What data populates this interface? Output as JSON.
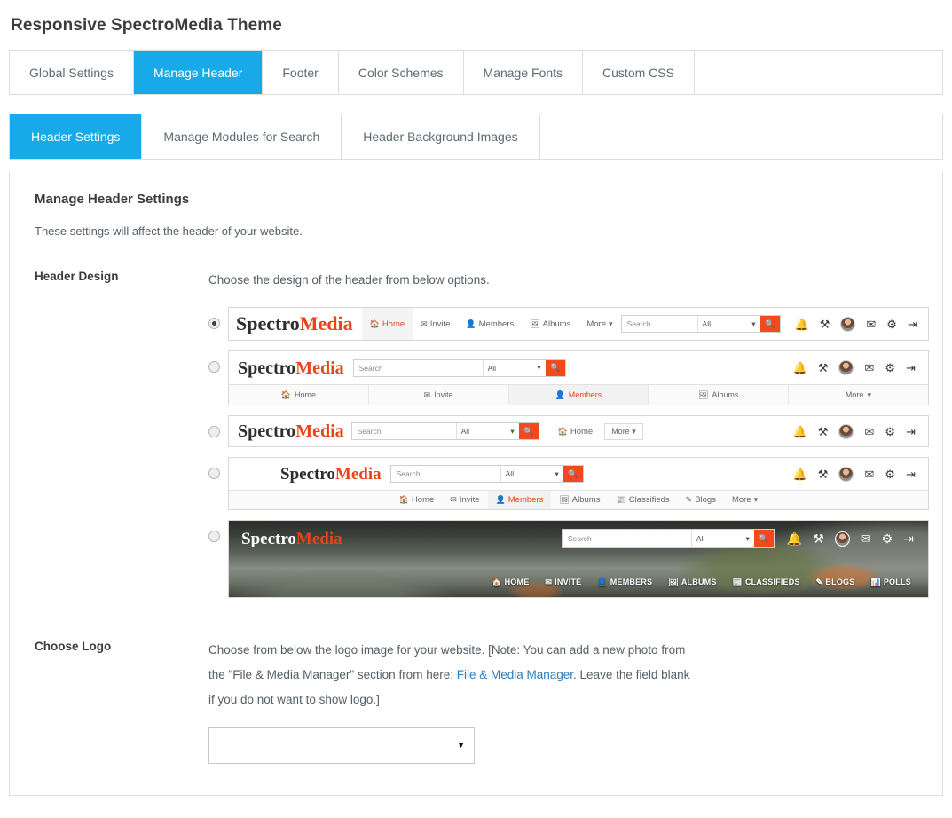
{
  "page": {
    "title": "Responsive SpectroMedia Theme"
  },
  "colors": {
    "accent_blue": "#17a9e8",
    "accent_orange": "#f4491c",
    "logo_orange": "#e8441c",
    "link_blue": "#2b7bb9",
    "border": "#dddddd"
  },
  "primary_tabs": [
    {
      "label": "Global Settings",
      "active": false
    },
    {
      "label": "Manage Header",
      "active": true
    },
    {
      "label": "Footer",
      "active": false
    },
    {
      "label": "Color Schemes",
      "active": false
    },
    {
      "label": "Manage Fonts",
      "active": false
    },
    {
      "label": "Custom CSS",
      "active": false
    }
  ],
  "secondary_tabs": [
    {
      "label": "Header Settings",
      "active": true
    },
    {
      "label": "Manage Modules for Search",
      "active": false
    },
    {
      "label": "Header Background Images",
      "active": false
    }
  ],
  "panel": {
    "heading": "Manage Header Settings",
    "description": "These settings will affect the header of your website."
  },
  "header_design": {
    "label": "Header Design",
    "help": "Choose the design of the header from below options.",
    "selected_index": 0
  },
  "logo": {
    "part1": "Spectro",
    "part2": "Media"
  },
  "search": {
    "placeholder": "Search",
    "scope": "All",
    "caret": "⌄",
    "button_icon": "search-icon"
  },
  "icons": {
    "bell": "bell-icon",
    "tools": "tools-icon",
    "avatar": "avatar-icon",
    "envelope": "envelope-icon",
    "gear": "gear-icon",
    "logout": "logout-icon"
  },
  "design1": {
    "nav": [
      {
        "label": "Home",
        "glyph": "🏠",
        "active": true
      },
      {
        "label": "Invite",
        "glyph": "✉",
        "active": false
      },
      {
        "label": "Members",
        "glyph": "👤",
        "active": false
      },
      {
        "label": "Albums",
        "glyph": "🖼",
        "active": false
      },
      {
        "label": "More",
        "glyph": "",
        "active": false,
        "caret": true
      }
    ]
  },
  "design2": {
    "nav": [
      {
        "label": "Home",
        "glyph": "🏠",
        "active": false
      },
      {
        "label": "Invite",
        "glyph": "✉",
        "active": false
      },
      {
        "label": "Members",
        "glyph": "👤",
        "active": true
      },
      {
        "label": "Albums",
        "glyph": "🖼",
        "active": false
      },
      {
        "label": "More",
        "glyph": "",
        "active": false,
        "caret": true
      }
    ]
  },
  "design3": {
    "nav": [
      {
        "label": "Home",
        "glyph": "🏠",
        "active": false
      }
    ],
    "more_label": "More"
  },
  "design4": {
    "nav": [
      {
        "label": "Home",
        "glyph": "🏠",
        "active": false
      },
      {
        "label": "Invite",
        "glyph": "✉",
        "active": false
      },
      {
        "label": "Members",
        "glyph": "👤",
        "active": true
      },
      {
        "label": "Albums",
        "glyph": "🖼",
        "active": false
      },
      {
        "label": "Classifieds",
        "glyph": "📰",
        "active": false
      },
      {
        "label": "Blogs",
        "glyph": "✎",
        "active": false
      },
      {
        "label": "More",
        "glyph": "",
        "active": false,
        "caret": true
      }
    ]
  },
  "design5": {
    "nav": [
      {
        "label": "HOME",
        "glyph": "🏠",
        "active": false
      },
      {
        "label": "INVITE",
        "glyph": "✉",
        "active": false
      },
      {
        "label": "MEMBERS",
        "glyph": "👤",
        "active": false
      },
      {
        "label": "ALBUMS",
        "glyph": "🖼",
        "active": false
      },
      {
        "label": "CLASSIFIEDS",
        "glyph": "📰",
        "active": false
      },
      {
        "label": "BLOGS",
        "glyph": "✎",
        "active": false
      },
      {
        "label": "POLLS",
        "glyph": "📊",
        "active": false
      }
    ]
  },
  "choose_logo": {
    "label": "Choose Logo",
    "help_part1": "Choose from below the logo image for your website. [Note: You can add a new photo from the \"File & Media Manager\" section from here: ",
    "link_text": "File & Media Manager",
    "help_part2": ". Leave the field blank if you do not want to show logo.]",
    "select_value": "",
    "select_caret": "▼"
  }
}
